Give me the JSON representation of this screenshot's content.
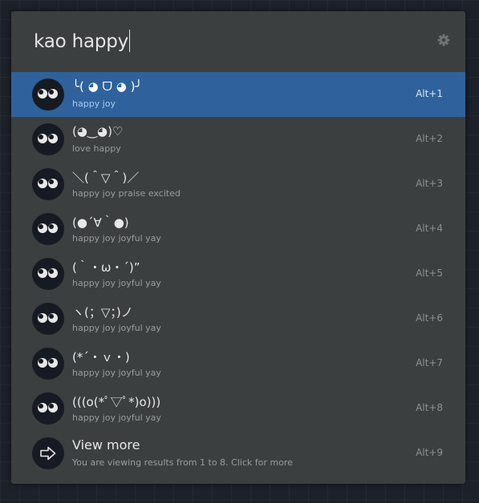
{
  "search": {
    "query": "kao happy",
    "settings_icon": "gear-icon"
  },
  "results": [
    {
      "kaomoji": "╰( ◕ ᗜ ◕ )╯",
      "tags": "happy joy",
      "shortcut": "Alt+1",
      "selected": true
    },
    {
      "kaomoji": "(◕‿◕)♡",
      "tags": "love happy",
      "shortcut": "Alt+2"
    },
    {
      "kaomoji": "＼(＾▽＾)／",
      "tags": "happy joy praise excited",
      "shortcut": "Alt+3"
    },
    {
      "kaomoji": "(●´∀｀●)",
      "tags": "happy joy joyful yay",
      "shortcut": "Alt+4"
    },
    {
      "kaomoji": "(｀・ω・´)”",
      "tags": "happy joy joyful yay",
      "shortcut": "Alt+5"
    },
    {
      "kaomoji": "ヽ(；▽；)ノ",
      "tags": "happy joy joyful yay",
      "shortcut": "Alt+6"
    },
    {
      "kaomoji": "(*´・ｖ・)",
      "tags": "happy joy joyful yay",
      "shortcut": "Alt+7"
    },
    {
      "kaomoji": "(((o(*ﾟ▽ﾟ*)o)))",
      "tags": "happy joy joyful yay",
      "shortcut": "Alt+8"
    }
  ],
  "view_more": {
    "label": "View more",
    "description": "You are viewing results from 1 to 8. Click for more",
    "shortcut": "Alt+9",
    "icon": "arrow-right-icon"
  },
  "colors": {
    "window_bg": "#3b3f3f",
    "selected_bg": "#2f629c",
    "selected_subtitle": "#a9cdf1"
  }
}
